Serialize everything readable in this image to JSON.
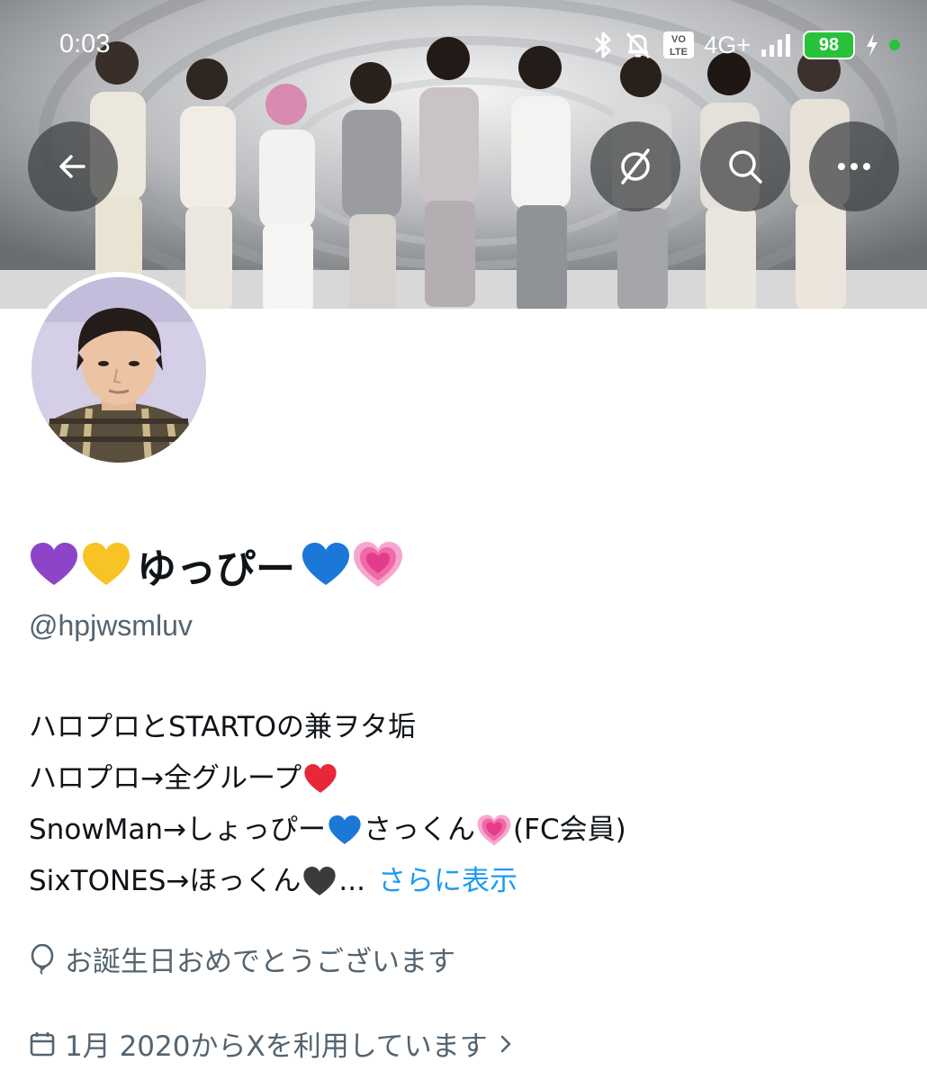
{
  "status_bar": {
    "time": "0:03",
    "network": "4G+",
    "volte_label": "VoLTE",
    "battery": "98"
  },
  "header": {
    "back_icon": "arrow-left-icon",
    "grok_icon": "grok-icon",
    "search_icon": "search-icon",
    "more_icon": "more-horizontal-icon"
  },
  "profile": {
    "name_prefix_emojis": [
      "purple-heart",
      "yellow-heart"
    ],
    "name": "ゆっぴー",
    "name_suffix_emojis": [
      "blue-heart",
      "growing-heart"
    ],
    "handle": "@hpjwsmluv",
    "bio": {
      "line1": "ハロプロとSTARTOの兼ヲタ垢",
      "line2": "ハロプロ→全グループ",
      "line3_a": "SnowMan→しょっぴー",
      "line3_b": "さっくん",
      "line3_c": "(FC会員)",
      "line4": "SixTONES→ほっくん",
      "line4_ellipsis": "...",
      "more_link": "さらに表示"
    },
    "birthday_text": "お誕生日おめでとうございます",
    "joined_text": "1月 2020からXを利用しています",
    "colors": {
      "link": "#1d9bf0",
      "secondary_text": "#536471",
      "primary_text": "#0f1419"
    }
  }
}
